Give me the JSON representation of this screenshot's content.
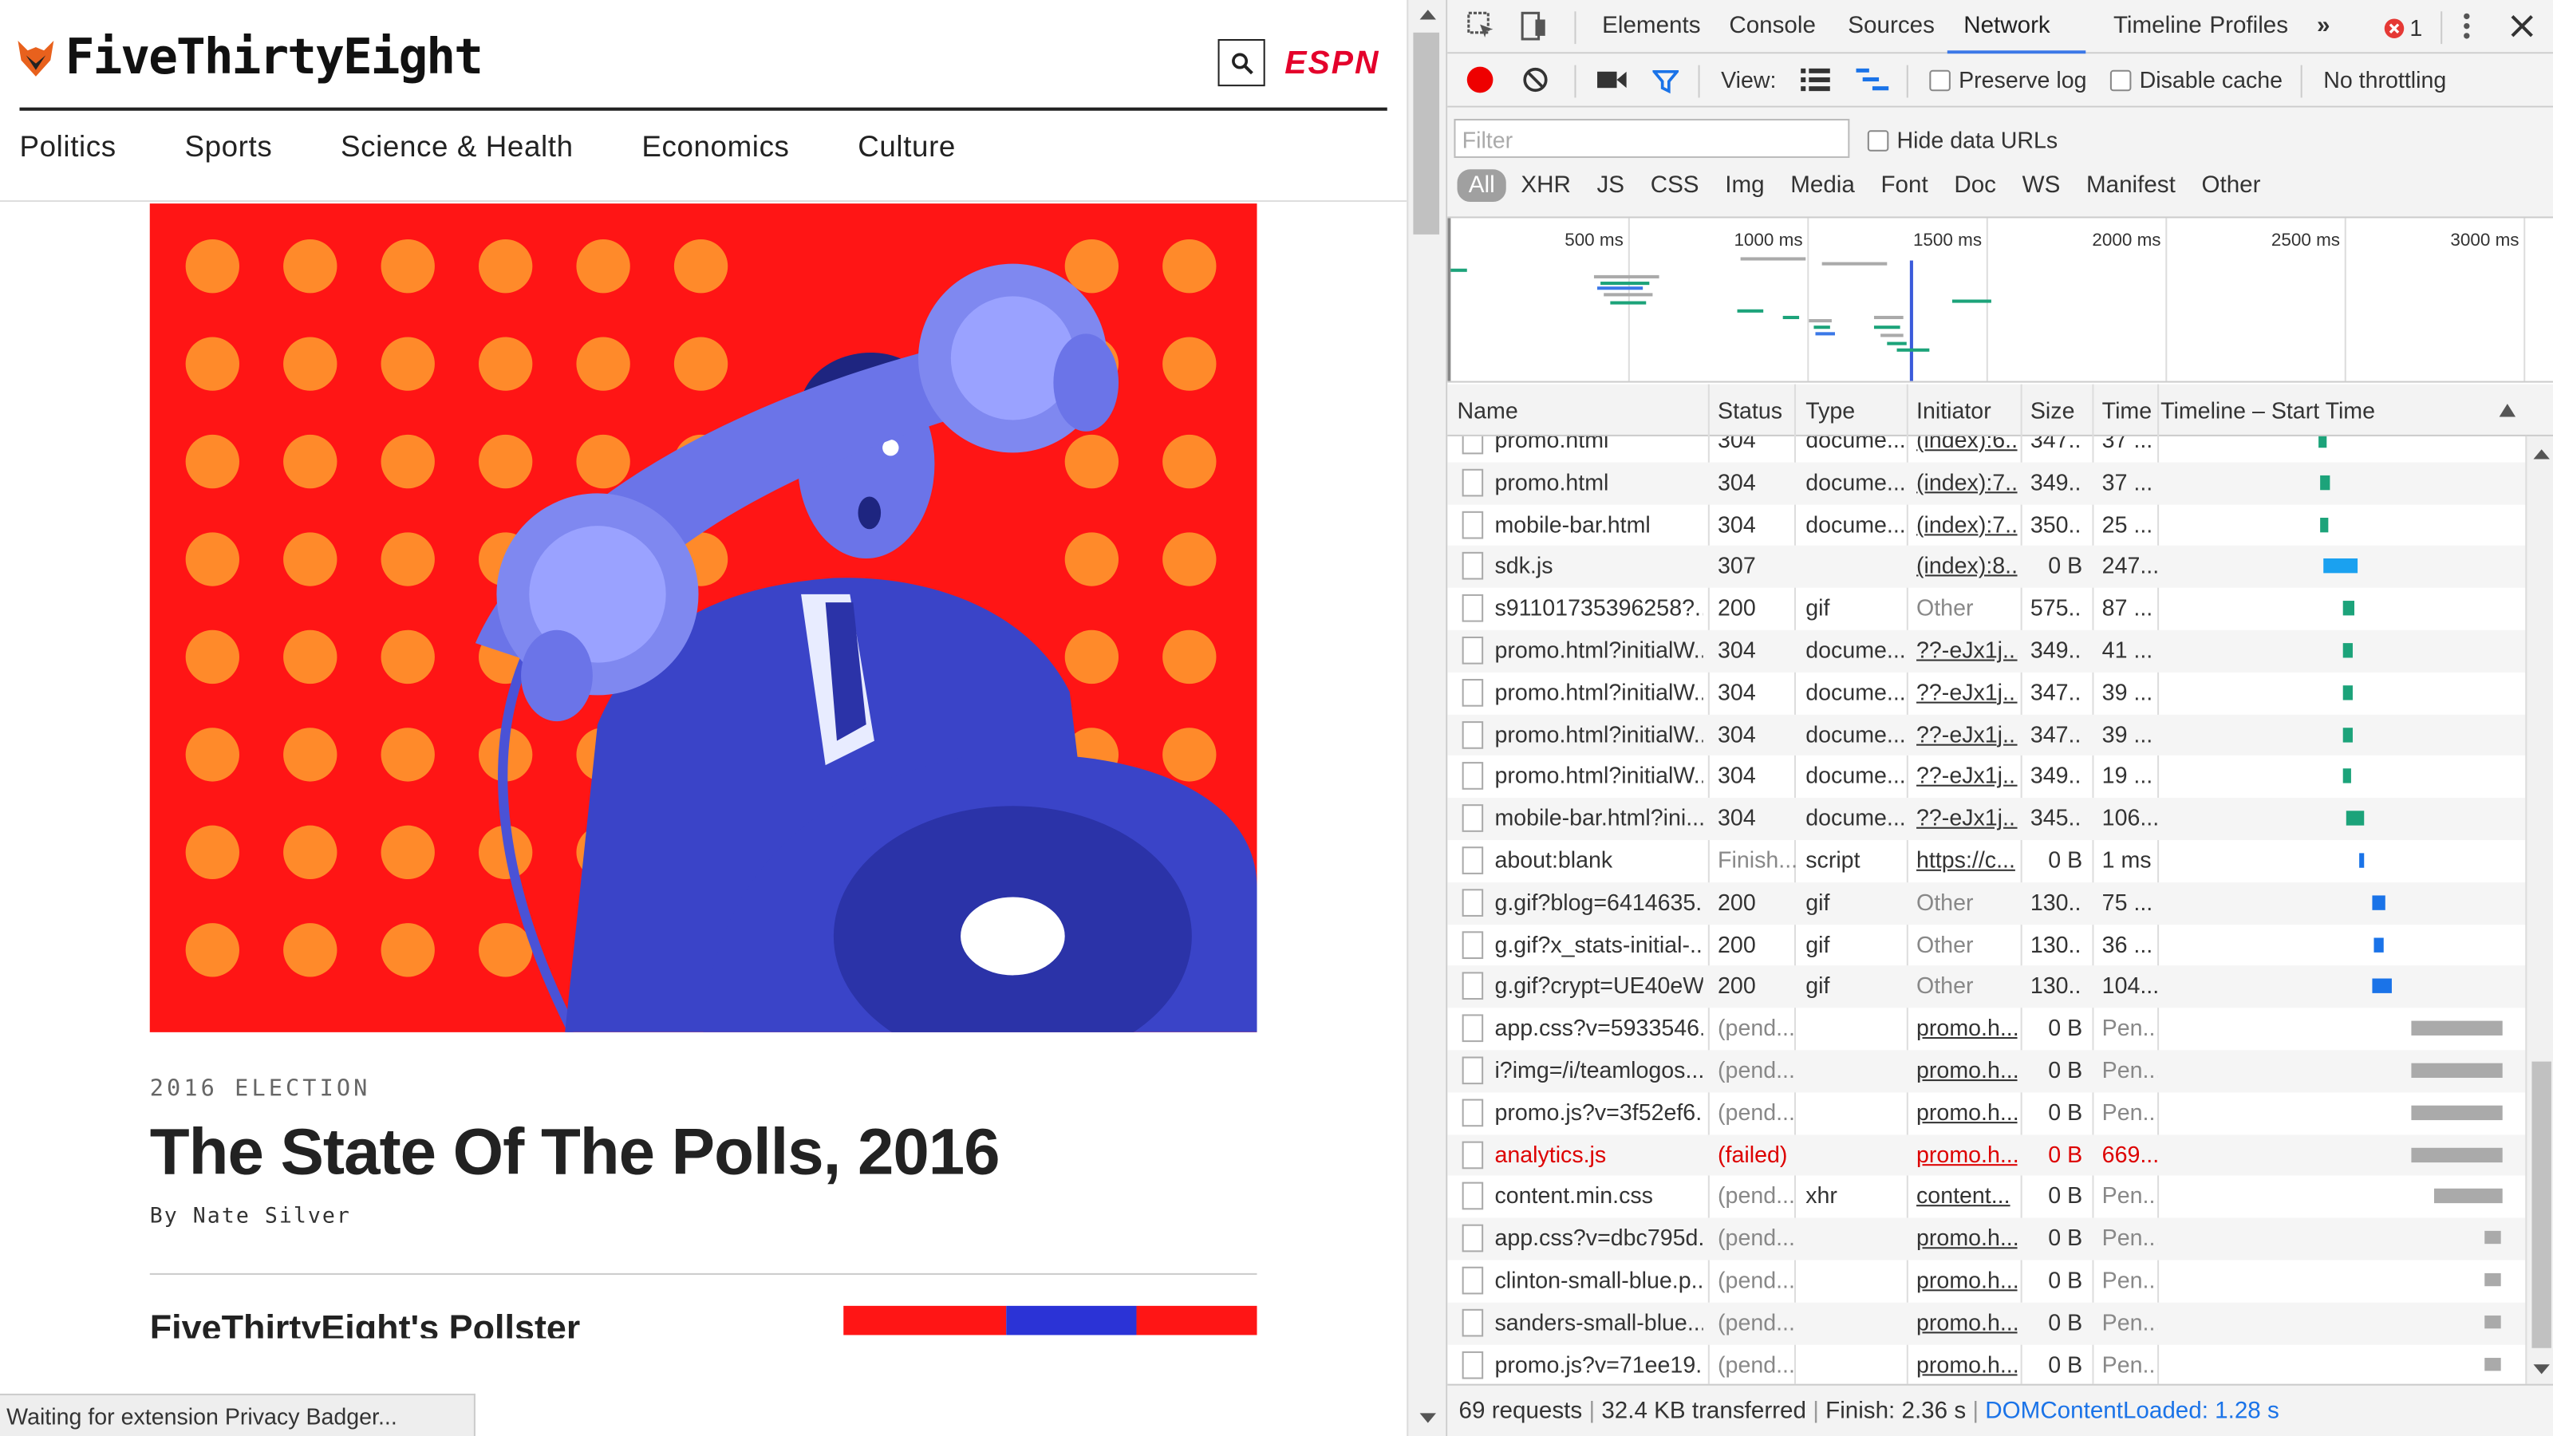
{
  "page": {
    "logo_text": "FiveThirtyEight",
    "espn_label": "ESPN",
    "nav": [
      "Politics",
      "Sports",
      "Science & Health",
      "Economics",
      "Culture"
    ],
    "kicker": "2016 ELECTION",
    "headline": "The State Of The Polls, 2016",
    "byline": "By Nate Silver",
    "teaser": "FiveThirtyEight's Pollster",
    "status_text": "Waiting for extension Privacy Badger..."
  },
  "devtools": {
    "tabs": [
      "Elements",
      "Console",
      "Sources",
      "Network",
      "Timeline",
      "Profiles"
    ],
    "active_tab": "Network",
    "error_count": "1",
    "toolbar": {
      "view_label": "View:",
      "preserve_log": "Preserve log",
      "disable_cache": "Disable cache",
      "throttling": "No throttling"
    },
    "filter_placeholder": "Filter",
    "hide_data_urls": "Hide data URLs",
    "types": [
      "All",
      "XHR",
      "JS",
      "CSS",
      "Img",
      "Media",
      "Font",
      "Doc",
      "WS",
      "Manifest",
      "Other"
    ],
    "overview_ticks": [
      "500 ms",
      "1000 ms",
      "1500 ms",
      "2000 ms",
      "2500 ms",
      "3000 ms"
    ],
    "columns": [
      "Name",
      "Status",
      "Type",
      "Initiator",
      "Size",
      "Time",
      "Timeline – Start Time"
    ],
    "rows": [
      {
        "name": "promo.html",
        "status": "304",
        "type": "docume...",
        "initiator": "(index):6...",
        "size": "347...",
        "time": "37 ..."
      },
      {
        "name": "promo.html",
        "status": "304",
        "type": "docume...",
        "initiator": "(index):7...",
        "size": "349...",
        "time": "37 ..."
      },
      {
        "name": "mobile-bar.html",
        "status": "304",
        "type": "docume...",
        "initiator": "(index):7...",
        "size": "350...",
        "time": "25 ..."
      },
      {
        "name": "sdk.js",
        "status": "307",
        "type": "",
        "initiator": "(index):8...",
        "size": "0 B",
        "time": "247..."
      },
      {
        "name": "s91101735396258?...",
        "status": "200",
        "type": "gif",
        "initiator": "Other",
        "size": "575...",
        "time": "87 ..."
      },
      {
        "name": "promo.html?initialW...",
        "status": "304",
        "type": "docume...",
        "initiator": "??-eJx1j...",
        "size": "349...",
        "time": "41 ..."
      },
      {
        "name": "promo.html?initialW...",
        "status": "304",
        "type": "docume...",
        "initiator": "??-eJx1j...",
        "size": "347...",
        "time": "39 ..."
      },
      {
        "name": "promo.html?initialW...",
        "status": "304",
        "type": "docume...",
        "initiator": "??-eJx1j...",
        "size": "347...",
        "time": "39 ..."
      },
      {
        "name": "promo.html?initialW...",
        "status": "304",
        "type": "docume...",
        "initiator": "??-eJx1j...",
        "size": "349...",
        "time": "19 ..."
      },
      {
        "name": "mobile-bar.html?ini...",
        "status": "304",
        "type": "docume...",
        "initiator": "??-eJx1j...",
        "size": "345...",
        "time": "106..."
      },
      {
        "name": "about:blank",
        "status": "Finish...",
        "type": "script",
        "initiator": "https://c...",
        "size": "0 B",
        "time": "1 ms"
      },
      {
        "name": "g.gif?blog=6414635...",
        "status": "200",
        "type": "gif",
        "initiator": "Other",
        "size": "130...",
        "time": "75 ..."
      },
      {
        "name": "g.gif?x_stats-initial-...",
        "status": "200",
        "type": "gif",
        "initiator": "Other",
        "size": "130...",
        "time": "36 ..."
      },
      {
        "name": "g.gif?crypt=UE40eW...",
        "status": "200",
        "type": "gif",
        "initiator": "Other",
        "size": "130...",
        "time": "104..."
      },
      {
        "name": "app.css?v=5933546...",
        "status": "(pend...",
        "type": "",
        "initiator": "promo.h...",
        "size": "0 B",
        "time": "Pen..."
      },
      {
        "name": "i?img=/i/teamlogos...",
        "status": "(pend...",
        "type": "",
        "initiator": "promo.h...",
        "size": "0 B",
        "time": "Pen..."
      },
      {
        "name": "promo.js?v=3f52ef6...",
        "status": "(pend...",
        "type": "",
        "initiator": "promo.h...",
        "size": "0 B",
        "time": "Pen..."
      },
      {
        "name": "analytics.js",
        "status": "(failed)",
        "type": "",
        "initiator": "promo.h...",
        "size": "0 B",
        "time": "669..."
      },
      {
        "name": "content.min.css",
        "status": "(pend...",
        "type": "xhr",
        "initiator": "content...",
        "size": "0 B",
        "time": "Pen..."
      },
      {
        "name": "app.css?v=dbc795d...",
        "status": "(pend...",
        "type": "",
        "initiator": "promo.h...",
        "size": "0 B",
        "time": "Pen..."
      },
      {
        "name": "clinton-small-blue.p...",
        "status": "(pend...",
        "type": "",
        "initiator": "promo.h...",
        "size": "0 B",
        "time": "Pen..."
      },
      {
        "name": "sanders-small-blue....",
        "status": "(pend...",
        "type": "",
        "initiator": "promo.h...",
        "size": "0 B",
        "time": "Pen..."
      },
      {
        "name": "promo.js?v=71ee19...",
        "status": "(pend...",
        "type": "",
        "initiator": "promo.h...",
        "size": "0 B",
        "time": "Pen..."
      }
    ],
    "summary": {
      "requests": "69 requests",
      "transferred": "32.4 KB transferred",
      "finish": "Finish: 2.36 s",
      "dcl": "DOMContentLoaded: 1.28 s"
    }
  }
}
